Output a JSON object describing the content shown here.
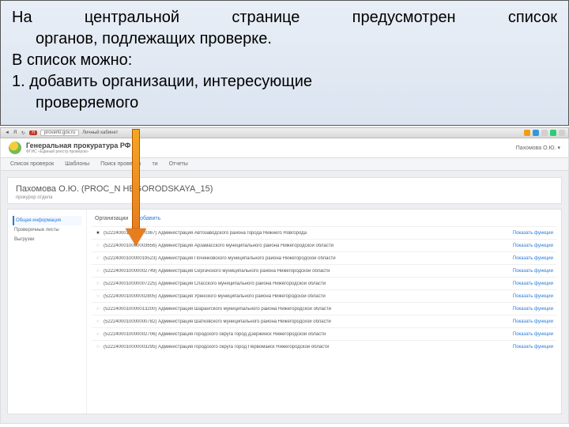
{
  "callout": {
    "l1": "На центральной странице предусмотрен список",
    "l2": "органов, подлежащих проверке.",
    "l3": "В список можно:",
    "l4": "1.  добавить организации, интересующие",
    "l5": "проверяемого"
  },
  "browser": {
    "yandex": "Я",
    "site_badge": "Н",
    "url": "proverki.gov.ru",
    "tab_title": "Личный кабинет"
  },
  "header": {
    "title": "Генеральная прокуратура РФ",
    "subtitle": "ФГИС «Единый реестр проверок»",
    "user": "Пахомова О.Ю. ▾"
  },
  "menu": {
    "m1": "Список проверок",
    "m2": "Шаблоны",
    "m3": "Поиск проверок",
    "m4": "ти",
    "m5": "Отчеты"
  },
  "profile": {
    "name": "Пахомова О.Ю. (PROC_N    HEGORODSKAYA_15)",
    "role": "прокурор отдела"
  },
  "sidenav": {
    "s1": "Общая информация",
    "s2": "Проверочные листы",
    "s3": "Выгрузки"
  },
  "orghead": {
    "label": "Организации",
    "add": "Добавить"
  },
  "show_fn": "Показать функции",
  "orgs": [
    {
      "star": true,
      "text": "(5222400010000170367) Администрация Автозаводского района города Нижнего Новгорода"
    },
    {
      "star": false,
      "text": "(5222400010000003656) Администрация Арзамасского муниципального района Нижегородской области"
    },
    {
      "star": false,
      "text": "(5222400010000019523) Администрация Починковского муниципального района Нижегородской области"
    },
    {
      "star": false,
      "text": "(5222400010000002749) Администрация Сергачского муниципального района Нижегородской области"
    },
    {
      "star": false,
      "text": "(5222400010000007225) Администрация Спасского муниципального района Нижегородской области"
    },
    {
      "star": false,
      "text": "(5222400010000002805) Администрация Уренского муниципального района Нижегородской области"
    },
    {
      "star": false,
      "text": "(5222400010000013200) Администрация Шарангского муниципального района Нижегородской области"
    },
    {
      "star": false,
      "text": "(5222400010000000782) Администрация Шатковского муниципального района Нижегородской области"
    },
    {
      "star": false,
      "text": "(5222400010000002706) Администрация городского округа город Дзержинск Нижегородской области"
    },
    {
      "star": false,
      "text": "(5222400010000003295) Администрация городского округа город Первомайск Нижегородской области"
    }
  ]
}
